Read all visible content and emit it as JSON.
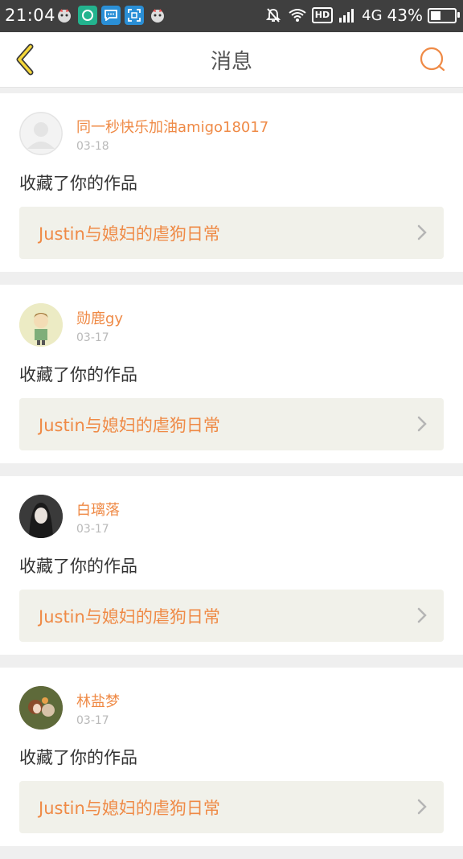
{
  "status_bar": {
    "time": "21:04",
    "network": "4G",
    "battery_percent": "43%",
    "battery_level": 0.43,
    "hd_label": "HD",
    "icons": [
      "app-icon-1",
      "app-icon-2",
      "chat-icon",
      "scan-icon",
      "app-icon-3",
      "mute-icon",
      "wifi-icon",
      "signal-icon",
      "battery-icon"
    ]
  },
  "header": {
    "title": "消息",
    "accent_color": "#ef8a46"
  },
  "messages": [
    {
      "username": "同一秒快乐加油amigo18017",
      "date": "03-18",
      "action": "收藏了你的作品",
      "work_title": "Justin与媳妇的虐狗日常"
    },
    {
      "username": "勋鹿gy",
      "date": "03-17",
      "action": "收藏了你的作品",
      "work_title": "Justin与媳妇的虐狗日常"
    },
    {
      "username": "白璃落",
      "date": "03-17",
      "action": "收藏了你的作品",
      "work_title": "Justin与媳妇的虐狗日常"
    },
    {
      "username": "林盐梦",
      "date": "03-17",
      "action": "收藏了你的作品",
      "work_title": "Justin与媳妇的虐狗日常"
    }
  ]
}
